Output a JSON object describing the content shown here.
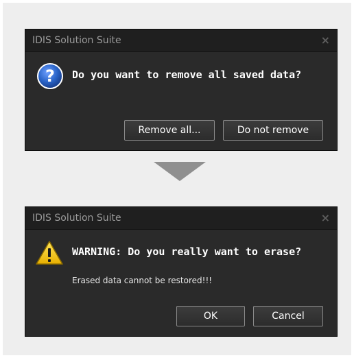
{
  "dialog1": {
    "title": "IDIS Solution Suite",
    "close_glyph": "×",
    "icon": "question-icon",
    "message": "Do you want to remove all saved data?",
    "buttons": {
      "remove_all": "Remove all...",
      "do_not_remove": "Do not remove"
    }
  },
  "dialog2": {
    "title": "IDIS Solution Suite",
    "close_glyph": "×",
    "icon": "warning-icon",
    "message": "WARNING: Do you really want to erase?",
    "submessage": "Erased data cannot be restored!!!",
    "buttons": {
      "ok": "OK",
      "cancel": "Cancel"
    }
  },
  "colors": {
    "dialog_bg": "#2a2a2a",
    "titlebar_bg": "#1f1f1f",
    "button_border": "#8a8a8a",
    "question_blue": "#2a64c8",
    "warning_yellow": "#f3c300",
    "arrow_gray": "#8f8f8f"
  }
}
